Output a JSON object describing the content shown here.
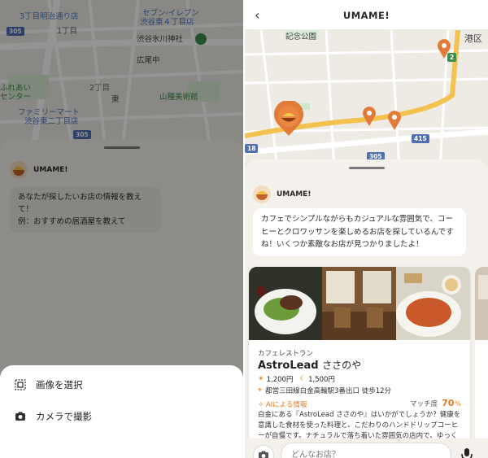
{
  "left": {
    "map_labels": {
      "l1": "3丁目明治通り店",
      "l2": "1丁目",
      "l3": "セブン-イレブン",
      "l4": "渋谷東４丁目店",
      "l5": "渋谷氷川神社",
      "l6": "広尾中",
      "l7": "2丁目",
      "l8": "ふれあい",
      "l9": "センター",
      "l10": "山種美術館",
      "l11": "東",
      "l12": "ファミリーマート",
      "l13": "渋谷東二丁目店",
      "r1": "305",
      "r2": "305"
    },
    "bot": {
      "name": "UMAME!"
    },
    "message": {
      "line1": "あなたが探したいお店の情報を教えて！",
      "line2": "例：おすすめの居酒屋を教えて"
    },
    "actions": {
      "select_image": "画像を選択",
      "take_photo": "カメラで撮影"
    }
  },
  "right": {
    "header": {
      "back": "‹",
      "title": "UMAME!"
    },
    "map_labels": {
      "park": "記念公園",
      "ward": "港区",
      "r415": "415",
      "r305": "305",
      "r18": "18",
      "r2": "2"
    },
    "bot": {
      "name": "UMAME!"
    },
    "message": "カフェでシンプルながらもカジュアルな雰囲気で、コーヒーとクロワッサンを楽しめるお店を探しているんですね！いくつか素敵なお店が見つかりましたよ！",
    "card": {
      "category": "カフェレストラン",
      "name_latin": "AstroLead",
      "name_jp": "ささのや",
      "lunch_price": "1,200円",
      "dinner_price": "1,500円",
      "access": "都営三田線白金高輪駅3番出口 徒歩12分",
      "ai_label": "AIによる情報",
      "match_label": "マッチ度",
      "match_value": "70",
      "match_unit": "%",
      "description": "白金にある『AstroLead ささのや』はいかがでしょうか？健康を意識した食材を使った料理と、こだわりのハンドドリップコーヒーが自慢です。ナチュラルで落ち着いた雰囲気の店内で、ゆっくりと"
    },
    "input": {
      "placeholder": "どんなお店？"
    }
  },
  "colors": {
    "accent": "#e07b1c",
    "pin": "#e07b3a",
    "road_major": "#f2c14e"
  }
}
